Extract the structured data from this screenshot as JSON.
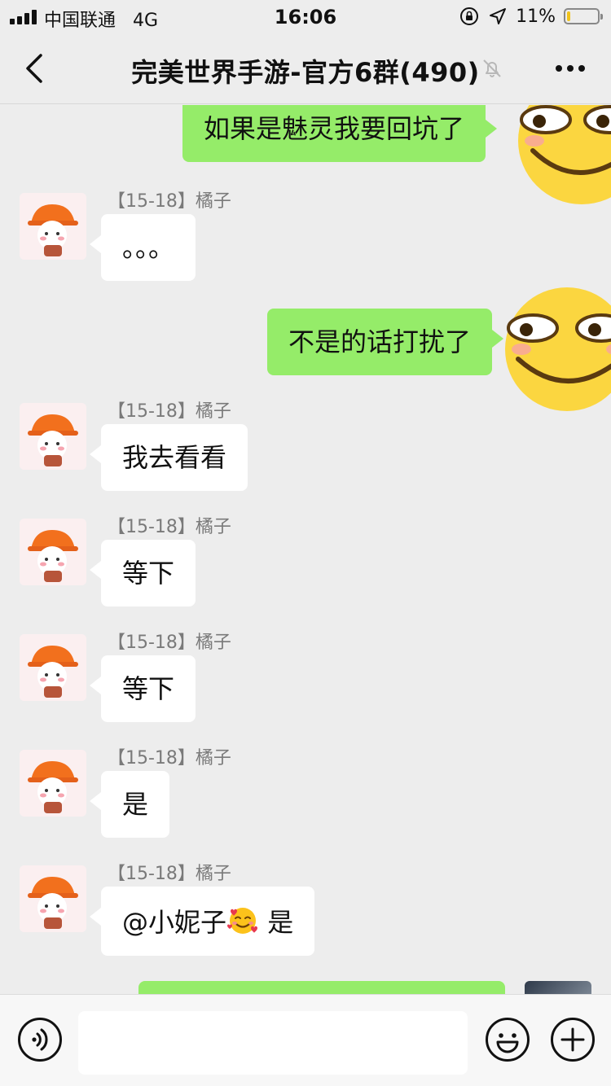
{
  "status_bar": {
    "carrier": "中国联通",
    "network": "4G",
    "time": "16:06",
    "battery_percent": "11%",
    "battery_level": 0.11,
    "icons": [
      "signal-icon",
      "orientation-lock-icon",
      "location-icon",
      "battery-icon"
    ]
  },
  "nav": {
    "title": "完美世界手游-官方6群(490)",
    "icons": [
      "back-chevron-icon",
      "mute-bell-icon",
      "more-dots-icon"
    ]
  },
  "messages": [
    {
      "side": "out",
      "text": "如果是魅灵我要回坑了",
      "after": "grinning-face-sticker"
    },
    {
      "side": "in",
      "sender": "【15-18】橘子",
      "text": "。。。"
    },
    {
      "side": "out",
      "text": "不是的话打扰了",
      "after": "grinning-face-sticker"
    },
    {
      "side": "in",
      "sender": "【15-18】橘子",
      "text": "我去看看"
    },
    {
      "side": "in",
      "sender": "【15-18】橘子",
      "text": "等下"
    },
    {
      "side": "in",
      "sender": "【15-18】橘子",
      "text": "等下"
    },
    {
      "side": "in",
      "sender": "【15-18】橘子",
      "text": "是"
    },
    {
      "side": "in",
      "sender": "【15-18】橘子",
      "text_before": "@小妮子",
      "emoji": "smiling-face-with-hearts",
      "text_after": " 是"
    },
    {
      "side": "out",
      "text": ""
    }
  ],
  "input": {
    "value": "",
    "icons": [
      "voice-icon",
      "emoji-face-icon",
      "plus-icon"
    ]
  },
  "colors": {
    "background": "#ededed",
    "outgoing_bubble": "#95ec69",
    "incoming_bubble": "#ffffff",
    "sender_text": "#7a7a7a",
    "battery": "#f0c31b"
  }
}
